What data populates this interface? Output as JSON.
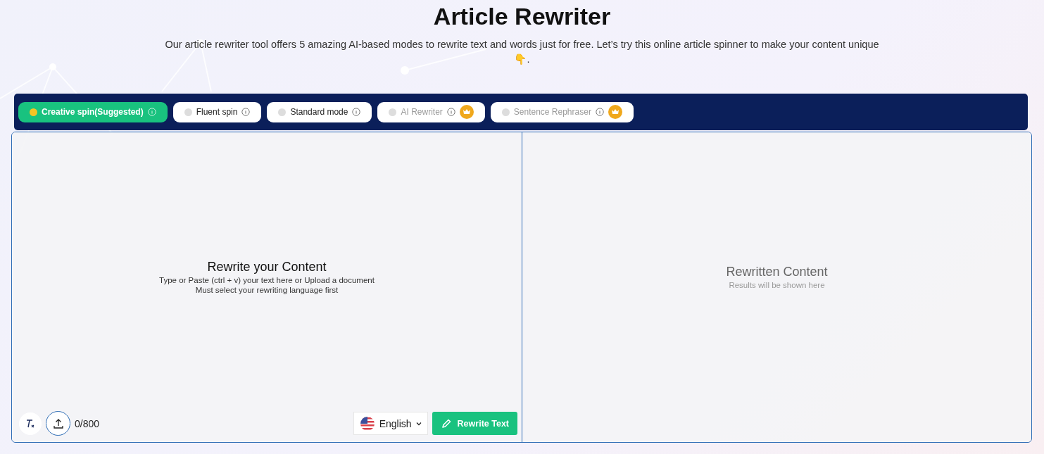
{
  "title": "Article Rewriter",
  "subtitle": "Our article rewriter tool offers 5 amazing AI-based modes to rewrite text and words just for free. Let’s try this online article spinner to make your content unique👇.",
  "modes": [
    {
      "label": "Creative spin(Suggested)",
      "selected": true,
      "premium": false
    },
    {
      "label": "Fluent spin",
      "selected": false,
      "premium": false
    },
    {
      "label": "Standard mode",
      "selected": false,
      "premium": false
    },
    {
      "label": "AI Rewriter",
      "selected": false,
      "premium": true
    },
    {
      "label": "Sentence Rephraser",
      "selected": false,
      "premium": true
    }
  ],
  "input": {
    "heading": "Rewrite your Content",
    "hint": "Type or Paste (ctrl + v) your text here or Upload a document",
    "note": "Must select your rewriting language first",
    "counter": "0/800",
    "language": "English",
    "button": "Rewrite Text"
  },
  "output": {
    "heading": "Rewritten Content",
    "hint": "Results will be shown here"
  }
}
